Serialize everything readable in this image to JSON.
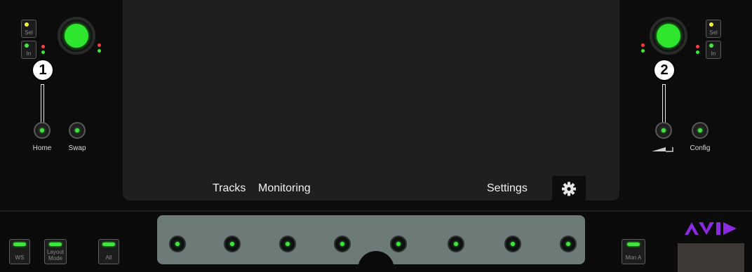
{
  "left_panel": {
    "sel_label": "Sel",
    "in_label": "In",
    "number": "1",
    "home_label": "Home",
    "swap_label": "Swap"
  },
  "right_panel": {
    "sel_label": "Sel",
    "in_label": "In",
    "number": "2",
    "config_label": "Config",
    "level_icon": "level-wedge-icon"
  },
  "screen": {
    "tabs": [
      "Tracks",
      "Monitoring",
      "Settings"
    ],
    "settings_icon": "gear-icon"
  },
  "bottom": {
    "ws_label": "WS",
    "layout_mode_label": "Layout Mode",
    "all_label": "All",
    "mon_a_label": "Mon A",
    "soft_key_count_icons": [
      "soft-key-1",
      "soft-key-2",
      "soft-key-3",
      "soft-key-4",
      "soft-key-5",
      "soft-key-6",
      "soft-key-7",
      "soft-key-8"
    ]
  },
  "colors": {
    "led_green": "#3ee63e",
    "led_red": "#ff3b3b",
    "led_yellow": "#f0f03a",
    "strip": "#6c7a78",
    "logo_purple": "#8a2be2"
  }
}
